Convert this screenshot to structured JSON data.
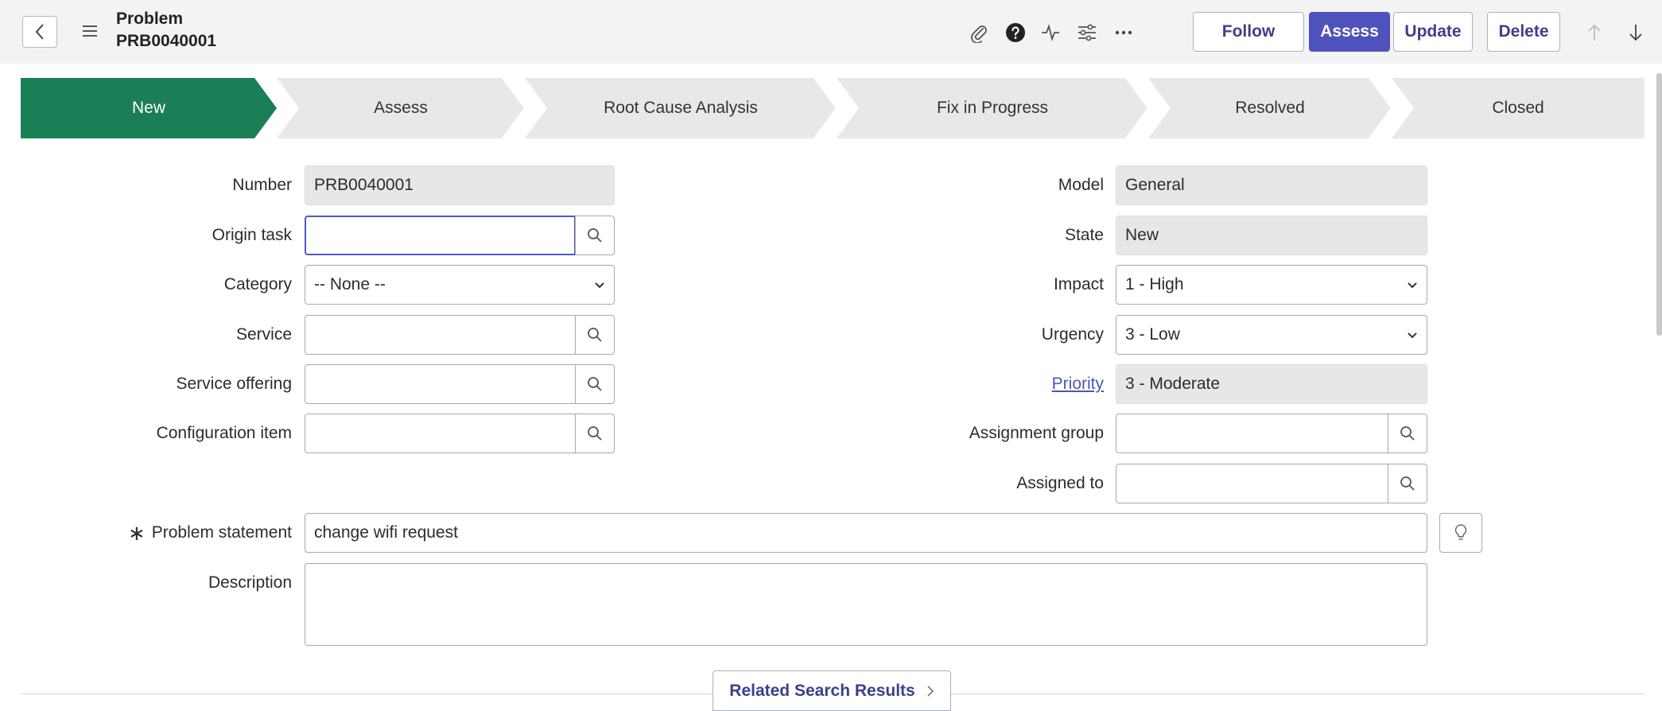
{
  "header": {
    "title": "Problem",
    "record_number": "PRB0040001",
    "icons": [
      "attachment-icon",
      "help-icon",
      "activity-icon",
      "settings-icon",
      "more-icon"
    ],
    "buttons": {
      "follow": "Follow",
      "assess": "Assess",
      "update": "Update",
      "delete": "Delete"
    },
    "accent_color": "#4f52bd"
  },
  "stages": {
    "items": [
      {
        "label": "New",
        "active": true
      },
      {
        "label": "Assess",
        "active": false
      },
      {
        "label": "Root Cause Analysis",
        "active": false
      },
      {
        "label": "Fix in Progress",
        "active": false
      },
      {
        "label": "Resolved",
        "active": false
      },
      {
        "label": "Closed",
        "active": false
      }
    ],
    "active_color": "#1a7f56",
    "inactive_color": "#e8e8e8"
  },
  "form": {
    "number": {
      "label": "Number",
      "value": "PRB0040001"
    },
    "origin_task": {
      "label": "Origin task",
      "value": ""
    },
    "category": {
      "label": "Category",
      "value": "-- None --"
    },
    "service": {
      "label": "Service",
      "value": ""
    },
    "service_offering": {
      "label": "Service offering",
      "value": ""
    },
    "configuration_item": {
      "label": "Configuration item",
      "value": ""
    },
    "model": {
      "label": "Model",
      "value": "General"
    },
    "state": {
      "label": "State",
      "value": "New"
    },
    "impact": {
      "label": "Impact",
      "value": "1 - High"
    },
    "urgency": {
      "label": "Urgency",
      "value": "3 - Low"
    },
    "priority": {
      "label": "Priority",
      "value": "3 - Moderate"
    },
    "assignment_group": {
      "label": "Assignment group",
      "value": ""
    },
    "assigned_to": {
      "label": "Assigned to",
      "value": ""
    },
    "problem_statement": {
      "required_mark": "∗",
      "label": "Problem statement",
      "value": "change wifi request"
    },
    "description": {
      "label": "Description",
      "value": ""
    }
  },
  "footer": {
    "related_search": "Related Search Results"
  }
}
